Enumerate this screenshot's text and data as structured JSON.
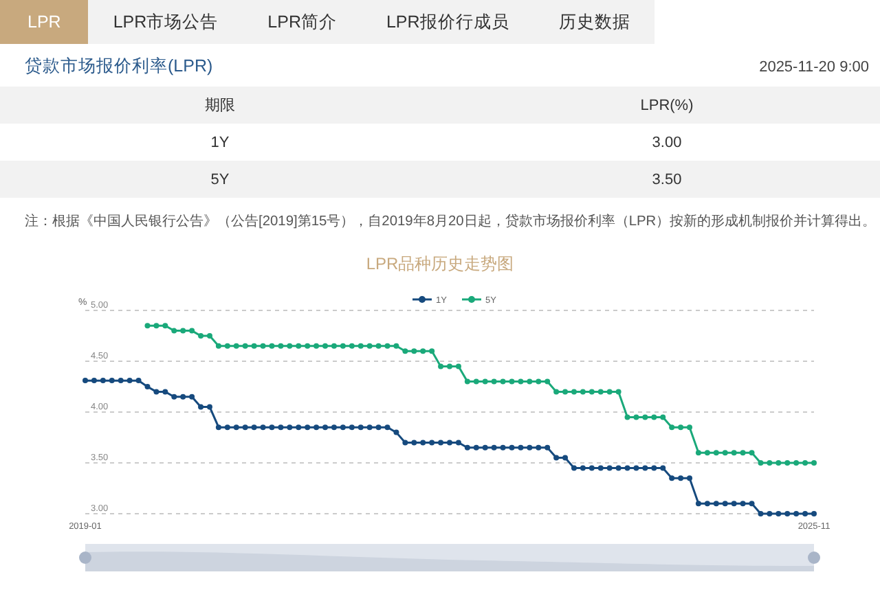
{
  "tabs": [
    {
      "label": "LPR",
      "selected": true
    },
    {
      "label": "LPR市场公告",
      "selected": false
    },
    {
      "label": "LPR简介",
      "selected": false
    },
    {
      "label": "LPR报价行成员",
      "selected": false
    },
    {
      "label": "历史数据",
      "selected": false
    }
  ],
  "header": {
    "title": "贷款市场报价利率(LPR)",
    "timestamp": "2025-11-20 9:00"
  },
  "table": {
    "columns": [
      "期限",
      "LPR(%)"
    ],
    "rows": [
      [
        "1Y",
        "3.00"
      ],
      [
        "5Y",
        "3.50"
      ]
    ]
  },
  "note": "注：根据《中国人民银行公告》（公告[2019]第15号），自2019年8月20日起，贷款市场报价利率（LPR）按新的形成机制报价并计算得出。",
  "chart": {
    "chart_data": {
      "type": "line",
      "title": "LPR品种历史走势图",
      "ylabel": "%",
      "ylim": [
        3,
        5
      ],
      "yticks": [
        {
          "value": 3,
          "label": "3.00"
        },
        {
          "value": 3.5,
          "label": "3.50"
        },
        {
          "value": 4,
          "label": "4.00"
        },
        {
          "value": 4.5,
          "label": "4.50"
        },
        {
          "value": 5,
          "label": "5.00"
        }
      ],
      "categories": [
        "2019-01",
        null,
        null,
        null,
        null,
        null,
        null,
        null,
        null,
        null,
        null,
        null,
        null,
        null,
        null,
        null,
        null,
        null,
        null,
        null,
        null,
        null,
        null,
        null,
        null,
        null,
        null,
        null,
        null,
        null,
        null,
        null,
        null,
        null,
        null,
        null,
        null,
        null,
        null,
        null,
        null,
        null,
        null,
        null,
        null,
        null,
        null,
        null,
        null,
        null,
        null,
        null,
        null,
        null,
        null,
        null,
        null,
        null,
        null,
        null,
        null,
        null,
        null,
        null,
        null,
        null,
        null,
        null,
        null,
        null,
        null,
        null,
        null,
        null,
        null,
        null,
        null,
        null,
        null,
        null,
        null,
        null,
        "2025-11"
      ],
      "series": [
        {
          "name": "1Y",
          "color": "#164a7e",
          "marker": "circle",
          "values": [
            4.31,
            4.31,
            4.31,
            4.31,
            4.31,
            4.31,
            4.31,
            4.25,
            4.2,
            4.2,
            4.15,
            4.15,
            4.15,
            4.05,
            4.05,
            3.85,
            3.85,
            3.85,
            3.85,
            3.85,
            3.85,
            3.85,
            3.85,
            3.85,
            3.85,
            3.85,
            3.85,
            3.85,
            3.85,
            3.85,
            3.85,
            3.85,
            3.85,
            3.85,
            3.85,
            3.8,
            3.7,
            3.7,
            3.7,
            3.7,
            3.7,
            3.7,
            3.7,
            3.65,
            3.65,
            3.65,
            3.65,
            3.65,
            3.65,
            3.65,
            3.65,
            3.65,
            3.65,
            3.55,
            3.55,
            3.45,
            3.45,
            3.45,
            3.45,
            3.45,
            3.45,
            3.45,
            3.45,
            3.45,
            3.45,
            3.45,
            3.35,
            3.35,
            3.35,
            3.1,
            3.1,
            3.1,
            3.1,
            3.1,
            3.1,
            3.1,
            3.0,
            3.0,
            3.0,
            3.0,
            3.0,
            3.0,
            3.0
          ]
        },
        {
          "name": "5Y",
          "color": "#1aa97a",
          "marker": "circle",
          "values": [
            null,
            null,
            null,
            null,
            null,
            null,
            null,
            4.85,
            4.85,
            4.85,
            4.8,
            4.8,
            4.8,
            4.75,
            4.75,
            4.65,
            4.65,
            4.65,
            4.65,
            4.65,
            4.65,
            4.65,
            4.65,
            4.65,
            4.65,
            4.65,
            4.65,
            4.65,
            4.65,
            4.65,
            4.65,
            4.65,
            4.65,
            4.65,
            4.65,
            4.65,
            4.6,
            4.6,
            4.6,
            4.6,
            4.45,
            4.45,
            4.45,
            4.3,
            4.3,
            4.3,
            4.3,
            4.3,
            4.3,
            4.3,
            4.3,
            4.3,
            4.3,
            4.2,
            4.2,
            4.2,
            4.2,
            4.2,
            4.2,
            4.2,
            4.2,
            3.95,
            3.95,
            3.95,
            3.95,
            3.95,
            3.85,
            3.85,
            3.85,
            3.6,
            3.6,
            3.6,
            3.6,
            3.6,
            3.6,
            3.6,
            3.5,
            3.5,
            3.5,
            3.5,
            3.5,
            3.5,
            3.5
          ]
        }
      ],
      "grid": true,
      "legend": true
    }
  }
}
